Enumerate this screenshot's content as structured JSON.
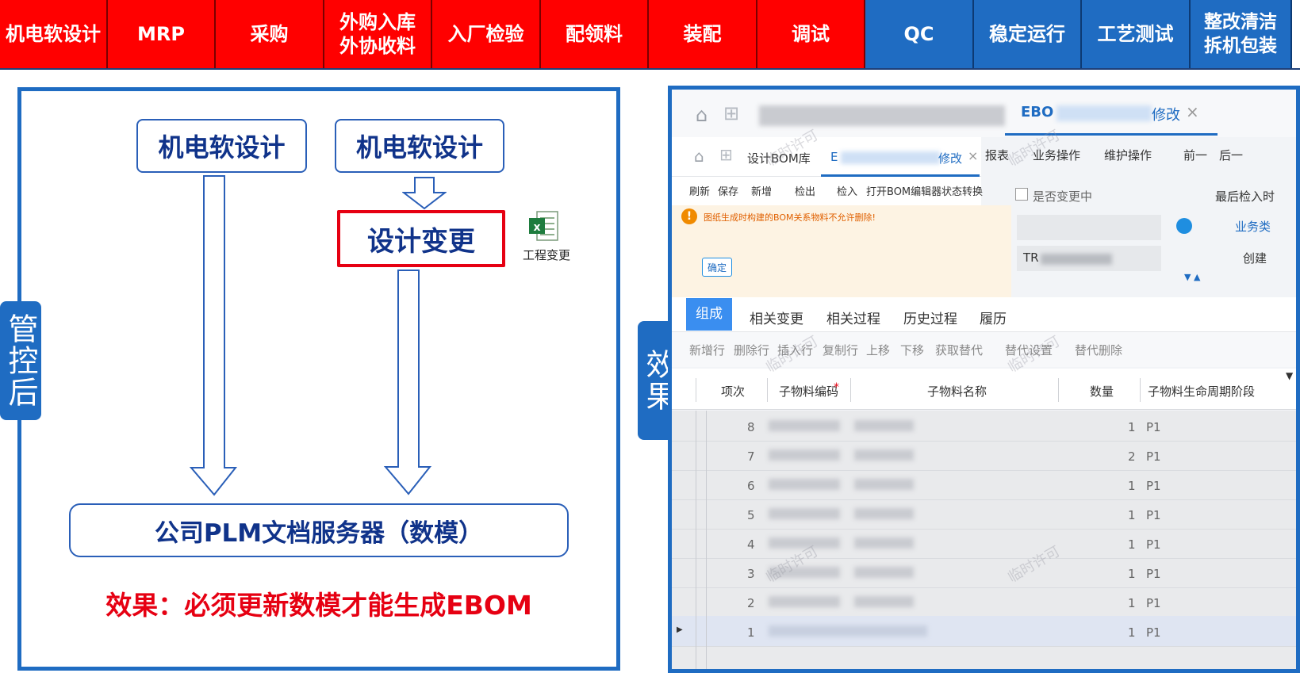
{
  "process_bar": {
    "steps": [
      {
        "label": "机电软设计",
        "color": "red"
      },
      {
        "label": "MRP",
        "color": "red"
      },
      {
        "label": "采购",
        "color": "red"
      },
      {
        "label": "外购入库\n外协收料",
        "color": "red"
      },
      {
        "label": "入厂检验",
        "color": "red"
      },
      {
        "label": "配领料",
        "color": "red"
      },
      {
        "label": "装配",
        "color": "red"
      },
      {
        "label": "调试",
        "color": "red"
      },
      {
        "label": "QC",
        "color": "blue"
      },
      {
        "label": "稳定运行",
        "color": "blue"
      },
      {
        "label": "工艺测试",
        "color": "blue"
      },
      {
        "label": "整改清洁\n拆机包装",
        "color": "blue"
      }
    ]
  },
  "left_panel": {
    "side_tag": "管控后",
    "box_design_left": "机电软设计",
    "box_design_right": "机电软设计",
    "box_change": "设计变更",
    "excel_label": "工程变更",
    "server_box": "公司PLM文档服务器（数模）",
    "effect_text": "效果：必须更新数模才能生成EBOM"
  },
  "right_tag": "效果",
  "screenshot": {
    "outer_tab_prefix": "EBO",
    "outer_tab_suffix": "修改",
    "inner_tab1": "设计BOM库",
    "inner_tab2_prefix": "E",
    "inner_tab2_suffix": "修改",
    "menus": [
      "报表",
      "业务操作",
      "维护操作",
      "前一",
      "后一"
    ],
    "toolbar": [
      "刷新",
      "保存",
      "新增",
      "检出",
      "检入",
      "打开BOM编辑器",
      "状态转换"
    ],
    "checkbox_label": "是否变更中",
    "last_checkin": "最后检入时",
    "business_label": "业务类",
    "create_label": "创建",
    "field_prefix": "TR",
    "alert_text": "图纸生成时构建的BOM关系物料不允许删除!",
    "alert_button": "确定",
    "tabs": [
      "组成",
      "相关变更",
      "相关过程",
      "历史过程",
      "履历"
    ],
    "row_tools": [
      "新增行",
      "删除行",
      "插入行",
      "复制行",
      "上移",
      "下移",
      "获取替代",
      "替代设置",
      "替代删除"
    ],
    "columns": [
      "项次",
      "子物料编码",
      "子物料名称",
      "数量",
      "子物料生命周期阶段"
    ],
    "required_mark": "*",
    "watermark": "临时许可",
    "rows": [
      {
        "no": "8",
        "qty": "1",
        "phase": "P1"
      },
      {
        "no": "7",
        "qty": "2",
        "phase": "P1"
      },
      {
        "no": "6",
        "qty": "1",
        "phase": "P1"
      },
      {
        "no": "5",
        "qty": "1",
        "phase": "P1"
      },
      {
        "no": "4",
        "qty": "1",
        "phase": "P1"
      },
      {
        "no": "3",
        "qty": "1",
        "phase": "P1"
      },
      {
        "no": "2",
        "qty": "1",
        "phase": "P1"
      },
      {
        "no": "1",
        "qty": "1",
        "phase": "P1"
      }
    ]
  },
  "colors": {
    "red": "#ff0000",
    "blue": "#1f6cc2",
    "navy_text": "#10338a",
    "effect_red": "#e60012",
    "alert_bg": "#fdf3e3",
    "alert_orange": "#f08a00"
  }
}
